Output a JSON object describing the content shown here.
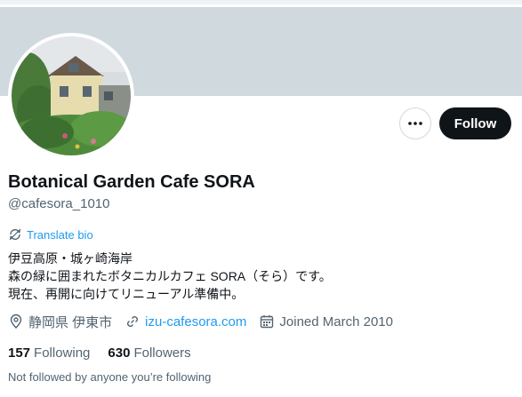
{
  "profile": {
    "name": "Botanical Garden Cafe SORA",
    "handle": "@cafesora_1010",
    "translate_label": "Translate bio",
    "bio_lines": [
      "伊豆高原・城ヶ崎海岸",
      "森の緑に囲まれたボタニカルカフェ SORA（そら）です。",
      "現在、再開に向けてリニューアル準備中。"
    ],
    "location": "静岡県 伊東市",
    "website": "izu-cafesora.com",
    "joined": "Joined March 2010",
    "following_count": "157",
    "following_label": "Following",
    "followers_count": "630",
    "followers_label": "Followers",
    "followed_by": "Not followed by anyone you’re following"
  },
  "actions": {
    "follow_label": "Follow",
    "more_icon": "more-horizontal-icon"
  },
  "colors": {
    "banner": "#cfd9de",
    "link": "#1d9bf0",
    "follow_bg": "#0f1419",
    "secondary_text": "#536471"
  },
  "icons": {
    "translate": "translate-icon",
    "location": "location-pin-icon",
    "link": "link-icon",
    "calendar": "calendar-icon"
  }
}
